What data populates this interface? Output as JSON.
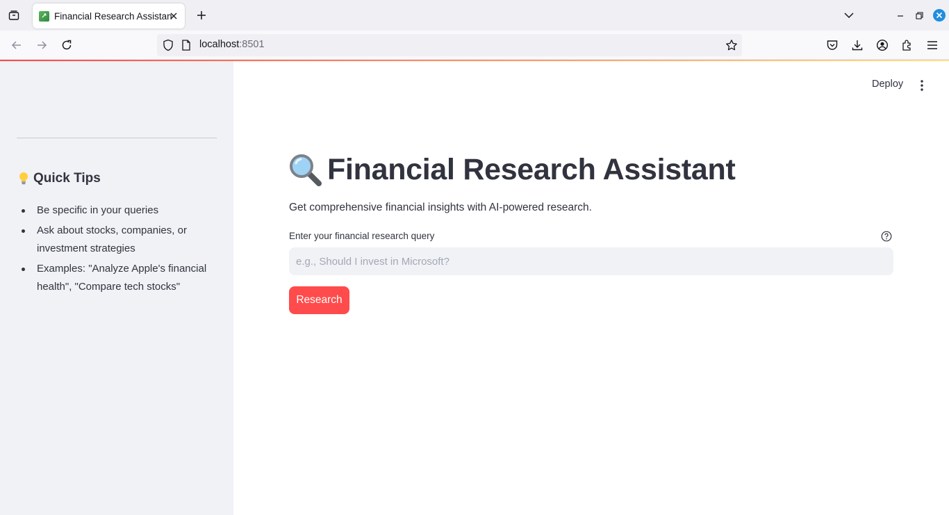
{
  "browser": {
    "tab": {
      "title": "Financial Research Assistant",
      "favicon": "chart-favicon"
    },
    "url": {
      "host": "localhost",
      "port": ":8501"
    }
  },
  "app": {
    "deploy_label": "Deploy",
    "sidebar": {
      "tips_heading": "Quick Tips",
      "tips": [
        "Be specific in your queries",
        "Ask about stocks, companies, or investment strategies",
        "Examples: \"Analyze Apple's financial health\", \"Compare tech stocks\""
      ]
    },
    "main": {
      "title": "Financial Research Assistant",
      "subtitle": "Get comprehensive financial insights with AI-powered research.",
      "query_label": "Enter your financial research query",
      "query_value": "",
      "query_placeholder": "e.g., Should I invest in Microsoft?",
      "research_button": "Research"
    }
  },
  "colors": {
    "primary": "#ff4b4b",
    "sidebar_bg": "#f0f2f6",
    "text": "#31333f"
  }
}
